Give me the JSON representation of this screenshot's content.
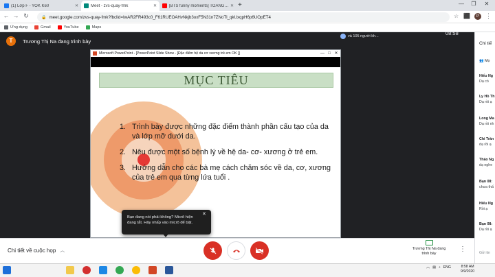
{
  "browser": {
    "tabs": [
      {
        "label": "(1) Lớp F - YOK K60",
        "fav_color": "#1877f2"
      },
      {
        "label": "Meet - zvs-quay-fmk",
        "fav_color": "#00897b"
      },
      {
        "label": "[BTS funny moments] TOANG!!!...",
        "fav_color": "#ff0000"
      }
    ],
    "new_tab": "+",
    "url": "meet.google.com/zvs-quay-fmk?fbclid=IwAR2FR493c0_F61RUEOAHvNkjb3oxF5N31n7ZNoTl_qkUxqpH6p6UOpET4",
    "profile_initial": "P",
    "bookmarks": [
      {
        "label": "Ứng dụng",
        "color": "#5f6368"
      },
      {
        "label": "Gmail",
        "color": "#ea4335"
      },
      {
        "label": "YouTube",
        "color": "#ff0000"
      },
      {
        "label": "Maps",
        "color": "#34a853"
      }
    ]
  },
  "meet": {
    "presenter_initial": "T",
    "presenter_title": "Trương Thị Na đang trình bày",
    "participants": "và 105 người kh...",
    "clock": "08:58",
    "ppt_title": "Microsoft PowerPoint - [PowerPoint Slide Show - [Đặc điểm hệ da cơ xương trẻ em OK ]]",
    "slide": {
      "heading": "MỤC TIÊU",
      "items": [
        {
          "num": "1.",
          "text": "Trình bày được những đặc điểm thành phần cấu tạo của da và lớp mỡ dưới da."
        },
        {
          "num": "2.",
          "text": "Nêu được một số bệnh lý về hệ da- cơ- xương ở trẻ em."
        },
        {
          "num": "3.",
          "text": "Hướng dẫn cho các bà mẹ cách chăm sóc về da, cơ, xương của trẻ em qua từng lứa tuổi ."
        }
      ]
    },
    "toast": "Bạn đang nói phải không? Micrô hiện đang tắt. Hãy nhấp vào micrô để bật.",
    "meeting_details": "Chi tiết về cuộc họp",
    "present_status": "Trương Thị Na đang trình bày"
  },
  "chat": {
    "title": "Chi tiế",
    "entries": [
      {
        "name": "Hiếu Ng",
        "msg": "Dạ có"
      },
      {
        "name": "Ly Hồ Th",
        "msg": "Dạ rồi ạ"
      },
      {
        "name": "Long Ma",
        "msg": "Dạ rồi nh"
      },
      {
        "name": "Chi Trần",
        "msg": "dạ rồi ạ"
      },
      {
        "name": "Thảo Ng",
        "msg": "dạ nghe"
      },
      {
        "name": "Bạn 08:",
        "msg": "chưa thấ"
      },
      {
        "name": "Hiếu Ng",
        "msg": "Rồi ạ"
      },
      {
        "name": "Bạn 08:",
        "msg": "Dạ rồi ạ"
      }
    ],
    "footer": "Gửi tin"
  },
  "taskbar": {
    "lang": "ENG",
    "time": "8:58 AM",
    "date": "9/9/2020"
  },
  "colors": {
    "meet_bg": "#202124",
    "mic_off": "#d93025",
    "slide_banner": "#c9dfc5",
    "target_outer": "#f4c29a",
    "target_mid": "#ee9a6a",
    "target_core": "#e53935"
  }
}
